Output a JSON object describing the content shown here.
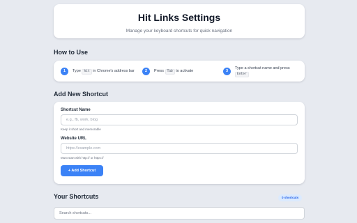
{
  "header": {
    "title": "Hit Links Settings",
    "subtitle": "Manage your keyboard shortcuts for quick navigation"
  },
  "how_to_use": {
    "title": "How to Use",
    "steps": [
      {
        "number": "1",
        "before": "Type",
        "key": "hit",
        "after": "in Chrome's address bar"
      },
      {
        "number": "2",
        "before": "Press",
        "key": "Tab",
        "after": "to activate"
      },
      {
        "number": "3",
        "before": "Type a shortcut name and press",
        "key": "Enter",
        "after": ""
      }
    ]
  },
  "add_shortcut": {
    "title": "Add New Shortcut",
    "name_label": "Shortcut Name",
    "name_placeholder": "e.g., fb, work, blog",
    "name_hint": "Keep it short and memorable",
    "url_label": "Website URL",
    "url_placeholder": "https://example.com",
    "url_hint": "Must start with http:// or https://",
    "button_icon": "plus-icon",
    "button_label": "+ Add Shortcut"
  },
  "your_shortcuts": {
    "title": "Your Shortcuts",
    "count_badge": "0 shortcuts",
    "search_placeholder": "Search shortcuts..."
  },
  "colors": {
    "accent": "#3b82f6",
    "page_background": "#e7eaf0",
    "badge_background": "#dbeafe"
  }
}
